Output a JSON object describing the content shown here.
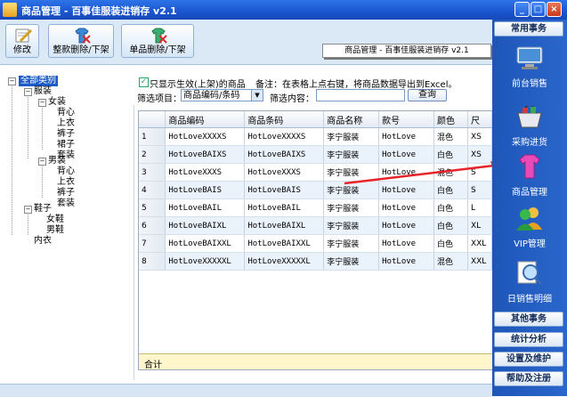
{
  "window": {
    "title": "商品管理 - 百事佳服装进销存 v2.1"
  },
  "toolbar": {
    "edit": "修改",
    "batch_delete": "整款删除/下架",
    "single_delete": "单品删除/下架",
    "banner": "商品管理 - 百事佳服装进销存 v2.1"
  },
  "tree": {
    "root": "全部类别",
    "clothing": "服装",
    "women": "女装",
    "women_items": [
      "背心",
      "上衣",
      "裤子",
      "裙子",
      "套装"
    ],
    "men": "男装",
    "men_items": [
      "背心",
      "上衣",
      "裤子",
      "套装"
    ],
    "shoes": "鞋子",
    "shoes_items": [
      "女鞋",
      "男鞋"
    ],
    "underwear": "内衣"
  },
  "filters": {
    "checkbox_label": "只显示生效(上架)的商品",
    "note": "备注：在表格上点右键，将商品数据导出到Excel。",
    "filter_item_label": "筛选项目：",
    "filter_item_value": "商品编码/条码",
    "filter_content_label": "筛选内容：",
    "filter_content_value": "",
    "search_button": "查询"
  },
  "grid": {
    "columns": [
      "",
      "商品编码",
      "商品条码",
      "商品名称",
      "款号",
      "颜色",
      "尺"
    ],
    "rows": [
      [
        "1",
        "HotLoveXXXXS",
        "HotLoveXXXXS",
        "李宁服装",
        "HotLove",
        "混色",
        "XS"
      ],
      [
        "2",
        "HotLoveBAIXS",
        "HotLoveBAIXS",
        "李宁服装",
        "HotLove",
        "白色",
        "XS"
      ],
      [
        "3",
        "HotLoveXXXS",
        "HotLoveXXXS",
        "李宁服装",
        "HotLove",
        "混色",
        "S"
      ],
      [
        "4",
        "HotLoveBAIS",
        "HotLoveBAIS",
        "李宁服装",
        "HotLove",
        "白色",
        "S"
      ],
      [
        "5",
        "HotLoveBAIL",
        "HotLoveBAIL",
        "李宁服装",
        "HotLove",
        "白色",
        "L"
      ],
      [
        "6",
        "HotLoveBAIXL",
        "HotLoveBAIXL",
        "李宁服装",
        "HotLove",
        "白色",
        "XL"
      ],
      [
        "7",
        "HotLoveBAIXXL",
        "HotLoveBAIXXL",
        "李宁服装",
        "HotLove",
        "白色",
        "XXL"
      ],
      [
        "8",
        "HotLoveXXXXXL",
        "HotLoveXXXXXL",
        "李宁服装",
        "HotLove",
        "混色",
        "XXL"
      ]
    ],
    "total_label": "合计"
  },
  "nav": {
    "top": "常用事务",
    "items": [
      "前台销售",
      "采购进货",
      "商品管理",
      "VIP管理",
      "日销售明细"
    ],
    "bottom": [
      "其他事务",
      "统计分析",
      "设置及维护",
      "帮助及注册"
    ]
  },
  "colors": {
    "titlebar": "#1a56d0",
    "nav": "#2a66cc",
    "selected_row": "#eaf2fb",
    "arrow": "#e8232a"
  }
}
